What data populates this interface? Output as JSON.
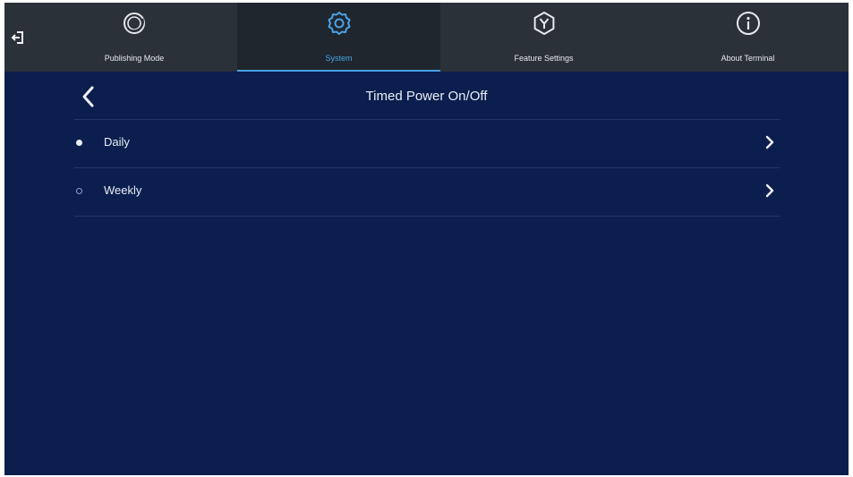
{
  "topbar": {
    "exit_icon": "exit-icon",
    "tabs": [
      {
        "label": "Publishing Mode",
        "icon": "publishing-mode-icon",
        "active": false
      },
      {
        "label": "System",
        "icon": "gear-icon",
        "active": true
      },
      {
        "label": "Feature Settings",
        "icon": "feature-settings-icon",
        "active": false
      },
      {
        "label": "About Terminal",
        "icon": "info-icon",
        "active": false
      }
    ]
  },
  "page": {
    "title": "Timed Power On/Off",
    "back_icon": "back-chevron-icon"
  },
  "options": [
    {
      "label": "Daily",
      "selected": true
    },
    {
      "label": "Weekly",
      "selected": false
    }
  ],
  "colors": {
    "background": "#0b1e4e",
    "topbar": "#2b3138",
    "accent": "#4aa3e6",
    "text": "#e9edf5"
  }
}
